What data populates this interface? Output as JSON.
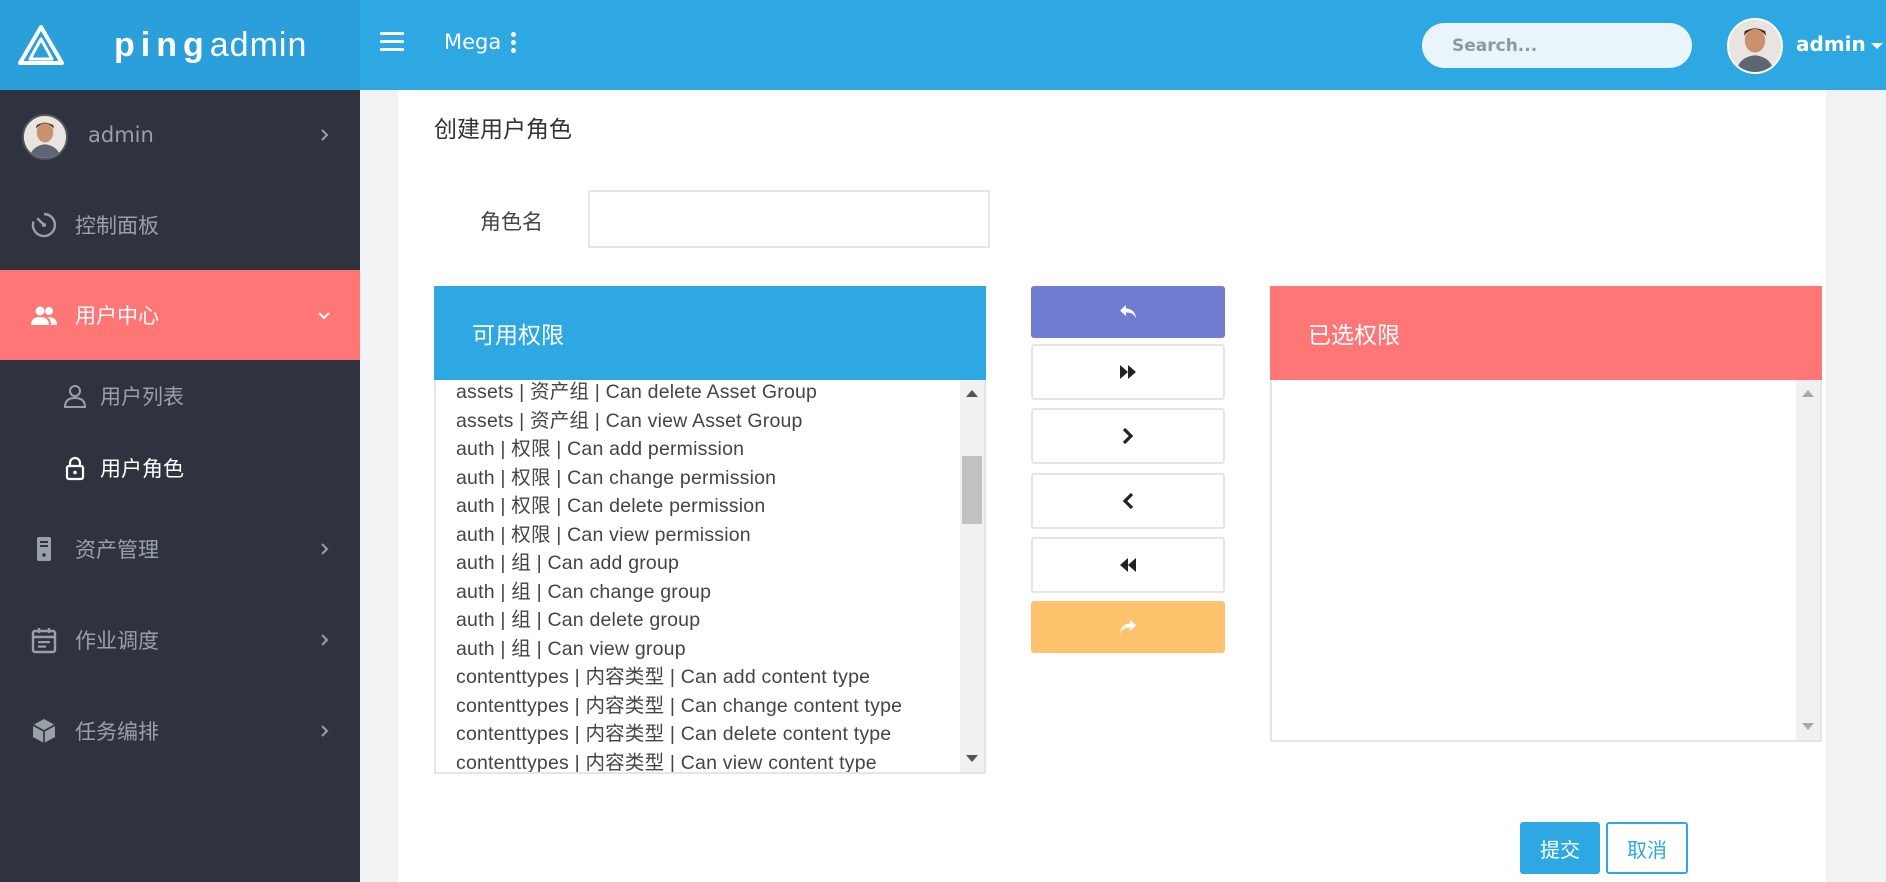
{
  "brand": {
    "bold": "ping",
    "light": "admin",
    "logo_icon": "triangle-logo-icon"
  },
  "topbar": {
    "menu_icon": "hamburger-icon",
    "mega_label": "Mega",
    "search_placeholder": "Search...",
    "user_name": "admin"
  },
  "sidebar": {
    "user": "admin",
    "items": [
      {
        "label": "控制面板",
        "icon": "dashboard-icon"
      },
      {
        "label": "用户中心",
        "icon": "users-icon"
      },
      {
        "label": "资产管理",
        "icon": "server-icon"
      },
      {
        "label": "作业调度",
        "icon": "calendar-icon"
      },
      {
        "label": "任务编排",
        "icon": "cube-icon"
      }
    ],
    "subitems": [
      {
        "label": "用户列表",
        "icon": "user-icon"
      },
      {
        "label": "用户角色",
        "icon": "lock-icon"
      }
    ]
  },
  "form": {
    "page_title": "创建用户角色",
    "role_label": "角色名",
    "role_value": "",
    "available_title": "可用权限",
    "selected_title": "已选权限",
    "available": [
      "assets | 资产组 | Can delete Asset Group",
      "assets | 资产组 | Can view Asset Group",
      "auth | 权限 | Can add permission",
      "auth | 权限 | Can change permission",
      "auth | 权限 | Can delete permission",
      "auth | 权限 | Can view permission",
      "auth | 组 | Can add group",
      "auth | 组 | Can change group",
      "auth | 组 | Can delete group",
      "auth | 组 | Can view group",
      "contenttypes | 内容类型 | Can add content type",
      "contenttypes | 内容类型 | Can change content type",
      "contenttypes | 内容类型 | Can delete content type",
      "contenttypes | 内容类型 | Can view content type"
    ],
    "selected": [],
    "submit_label": "提交",
    "cancel_label": "取消"
  },
  "colors": {
    "topbar": "#2ea8e3",
    "sidebar": "#2f333f",
    "active": "#ff7676",
    "undo": "#707cd2",
    "redo": "#ffc36d"
  }
}
